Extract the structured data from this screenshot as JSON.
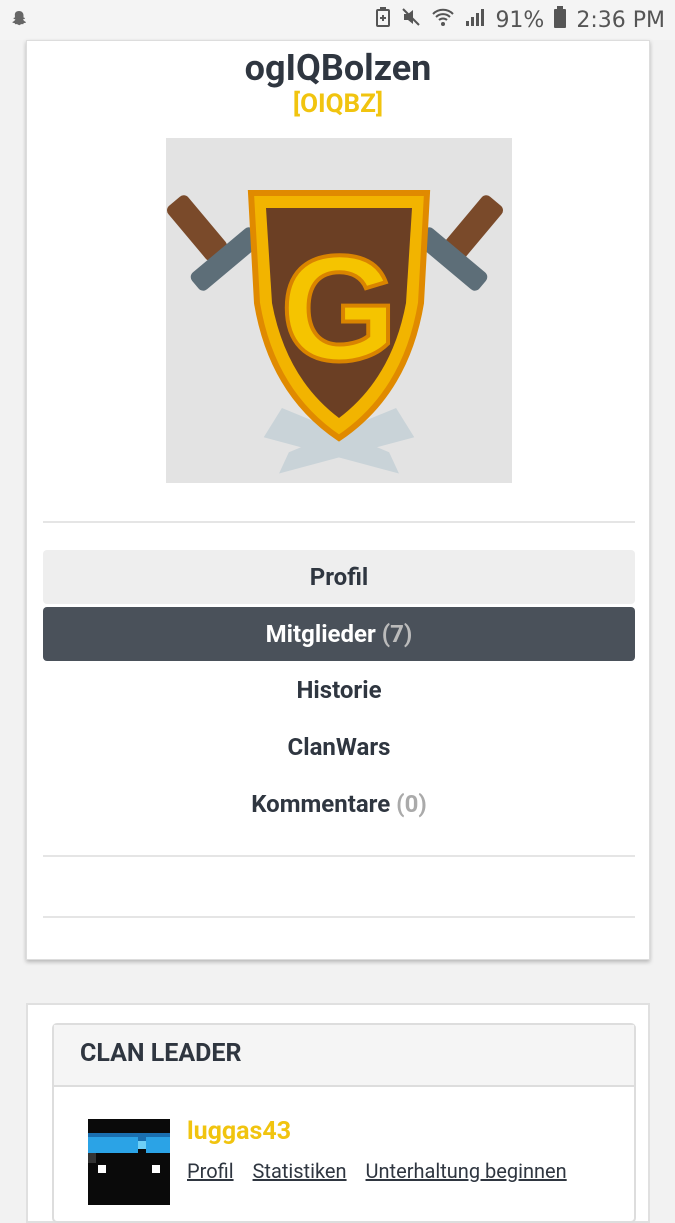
{
  "status_bar": {
    "battery_percent": "91%",
    "time": "2:36 PM"
  },
  "clan": {
    "name": "ogIQBolzen",
    "tag": "[OIQBZ]"
  },
  "nav": {
    "items": [
      {
        "label": "Profil",
        "count": ""
      },
      {
        "label": "Mitglieder",
        "count": "(7)"
      },
      {
        "label": "Historie",
        "count": ""
      },
      {
        "label": "ClanWars",
        "count": ""
      },
      {
        "label": "Kommentare",
        "count": "(0)"
      }
    ]
  },
  "leader": {
    "section_title": "CLAN LEADER",
    "name": "luggas43",
    "links": [
      "Profil",
      "Statistiken",
      "Unterhaltung beginnen"
    ]
  },
  "colors": {
    "accent": "#f1c40f",
    "dark": "#2f3640",
    "active_nav": "#4a515a"
  }
}
